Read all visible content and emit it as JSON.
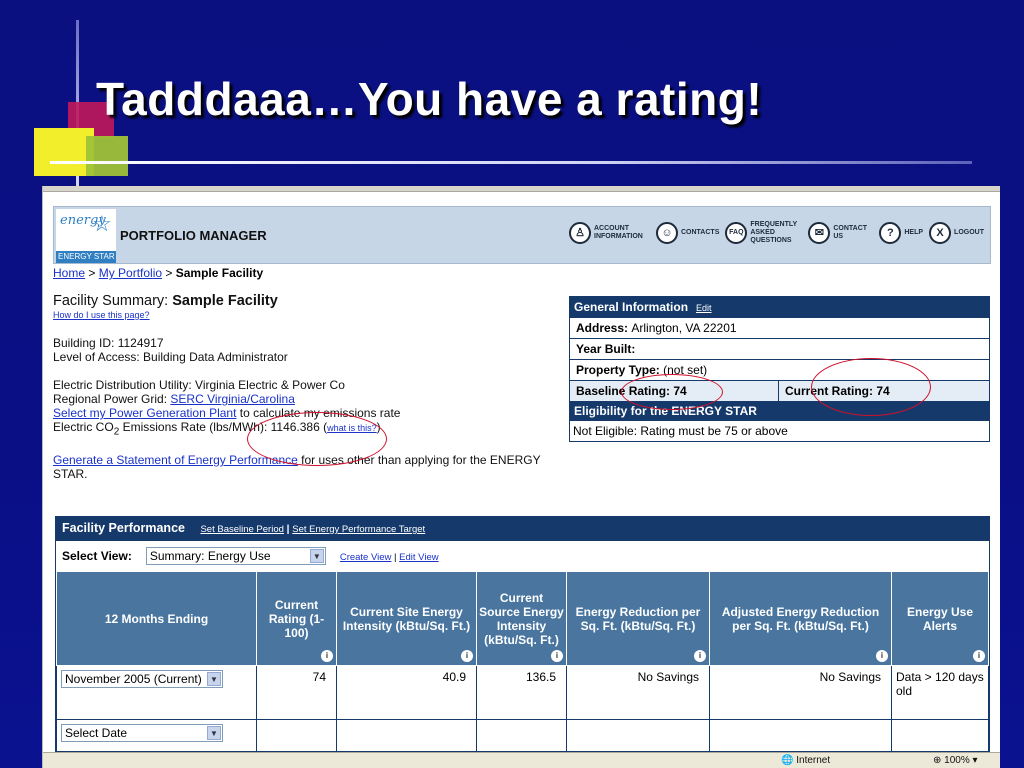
{
  "slide": {
    "title": "Tadddaaa…You have a rating!"
  },
  "header": {
    "logo_text": "energy",
    "logo_bar": "ENERGY STAR",
    "app_title": "PORTFOLIO MANAGER",
    "nav": [
      {
        "label": "ACCOUNT INFORMATION",
        "icon": "person-icon"
      },
      {
        "label": "CONTACTS",
        "icon": "contacts-icon"
      },
      {
        "label": "FREQUENTLY ASKED QUESTIONS",
        "icon": "faq-icon"
      },
      {
        "label": "CONTACT US",
        "icon": "mail-icon"
      },
      {
        "label": "HELP",
        "icon": "help-icon"
      },
      {
        "label": "LOGOUT",
        "icon": "logout-icon"
      }
    ]
  },
  "breadcrumb": {
    "home": "Home",
    "sep": " > ",
    "portfolio": "My Portfolio",
    "current": "Sample Facility"
  },
  "summary": {
    "label": "Facility Summary: ",
    "name": "Sample Facility",
    "how_link": "How do I use this page?",
    "building_id": "Building ID: 1124917",
    "access": "Level of Access: Building Data Administrator",
    "utility": "Electric Distribution Utility: Virginia Electric & Power Co",
    "grid_label": "Regional Power Grid: ",
    "grid_link": "SERC Virginia/Carolina",
    "plant_link": "Select my Power Generation Plant",
    "plant_text": " to calculate my emissions rate",
    "co2_a": "Electric CO",
    "co2_sub": "2",
    "co2_b": " Emissions Rate (lbs/MWh): 1146.386 (",
    "co2_link": "what is this?",
    "co2_c": ")",
    "statement_link": "Generate a Statement of Energy Performance",
    "statement_text": " for uses other than applying for the ENERGY STAR."
  },
  "general": {
    "title": "General Information",
    "edit": "Edit",
    "address_label": "Address: ",
    "address": "Arlington, VA 22201",
    "year_label": "Year Built:",
    "property_label": "Property Type: ",
    "property": "(not set)",
    "baseline": "Baseline Rating: 74",
    "current": "Current Rating: 74",
    "eligibility_title": "Eligibility for the ENERGY STAR",
    "eligibility": "Not Eligible: Rating must be 75 or above"
  },
  "performance": {
    "title": "Facility Performance",
    "baseline_link": "Set Baseline Period",
    "sep": " | ",
    "target_link": "Set Energy Performance Target",
    "select_view_label": "Select View:",
    "view_value": "Summary: Energy Use",
    "create_view": "Create View",
    "view_sep": " | ",
    "edit_view": "Edit View",
    "columns": [
      "12 Months Ending",
      "Current Rating (1-100)",
      "Current Site Energy Intensity (kBtu/Sq. Ft.)",
      "Current Source Energy Intensity (kBtu/Sq. Ft.)",
      "Energy Reduction per Sq. Ft. (kBtu/Sq. Ft.)",
      "Adjusted Energy Reduction per Sq. Ft. (kBtu/Sq. Ft.)",
      "Energy Use Alerts"
    ],
    "row1": {
      "period": "November 2005 (Current)",
      "rating": "74",
      "site": "40.9",
      "source": "136.5",
      "reduction": "No Savings",
      "adjusted": "No Savings",
      "alerts": "Data > 120 days old"
    },
    "row2": {
      "period": "Select Date"
    }
  },
  "status": {
    "zone": "Internet",
    "zoom": "100%"
  }
}
